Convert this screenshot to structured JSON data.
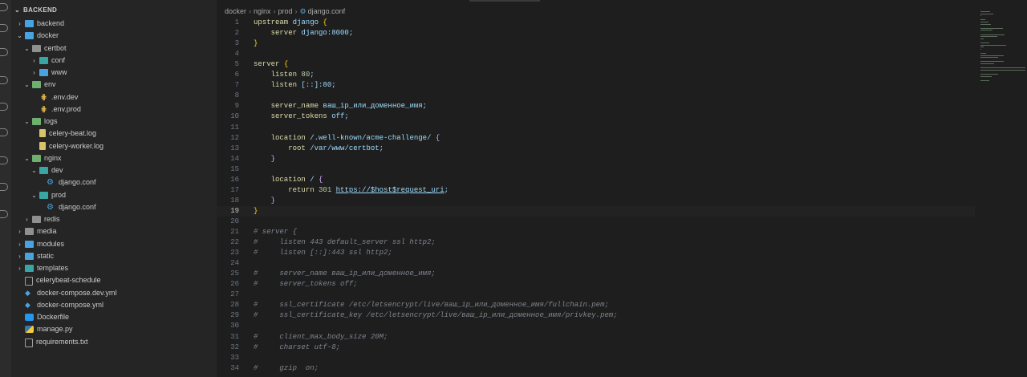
{
  "sidebar": {
    "header": "BACKEND",
    "items": [
      {
        "label": "backend",
        "depth": 1,
        "type": "folder",
        "icon": "folder-icon",
        "open": false,
        "color": "blue"
      },
      {
        "label": "docker",
        "depth": 1,
        "type": "folder",
        "icon": "docker-folder-icon",
        "open": true,
        "color": "blue"
      },
      {
        "label": "certbot",
        "depth": 2,
        "type": "folder",
        "icon": "folder-icon",
        "open": true,
        "color": "gray"
      },
      {
        "label": "conf",
        "depth": 3,
        "type": "folder",
        "icon": "config-folder-icon",
        "open": false,
        "color": "teal"
      },
      {
        "label": "www",
        "depth": 3,
        "type": "folder",
        "icon": "folder-icon",
        "open": false,
        "color": "blue"
      },
      {
        "label": "env",
        "depth": 2,
        "type": "folder",
        "icon": "env-folder-icon",
        "open": true,
        "color": "green"
      },
      {
        "label": ".env.dev",
        "depth": 3,
        "type": "env",
        "icon": "env-file-icon"
      },
      {
        "label": ".env.prod",
        "depth": 3,
        "type": "env",
        "icon": "env-file-icon"
      },
      {
        "label": "logs",
        "depth": 2,
        "type": "folder",
        "icon": "logs-folder-icon",
        "open": true,
        "color": "green"
      },
      {
        "label": "celery-beat.log",
        "depth": 3,
        "type": "log",
        "icon": "log-file-icon"
      },
      {
        "label": "celery-worker.log",
        "depth": 3,
        "type": "log",
        "icon": "log-file-icon"
      },
      {
        "label": "nginx",
        "depth": 2,
        "type": "folder",
        "icon": "nginx-folder-icon",
        "open": true,
        "color": "green"
      },
      {
        "label": "dev",
        "depth": 3,
        "type": "folder",
        "icon": "folder-icon",
        "open": true,
        "color": "teal"
      },
      {
        "label": "django.conf",
        "depth": 4,
        "type": "gear",
        "icon": "gear-icon"
      },
      {
        "label": "prod",
        "depth": 3,
        "type": "folder",
        "icon": "folder-icon",
        "open": true,
        "color": "teal"
      },
      {
        "label": "django.conf",
        "depth": 4,
        "type": "gear",
        "icon": "gear-icon"
      },
      {
        "label": "redis",
        "depth": 2,
        "type": "folder",
        "icon": "folder-icon",
        "open": false,
        "color": "gray"
      },
      {
        "label": "media",
        "depth": 1,
        "type": "folder",
        "icon": "folder-icon",
        "open": false,
        "color": "gray"
      },
      {
        "label": "modules",
        "depth": 1,
        "type": "folder",
        "icon": "folder-icon",
        "open": false,
        "color": "blue"
      },
      {
        "label": "static",
        "depth": 1,
        "type": "folder",
        "icon": "folder-icon",
        "open": false,
        "color": "blue"
      },
      {
        "label": "templates",
        "depth": 1,
        "type": "folder",
        "icon": "folder-icon",
        "open": false,
        "color": "teal"
      },
      {
        "label": "celerybeat-schedule",
        "depth": 1,
        "type": "txt",
        "icon": "file-icon"
      },
      {
        "label": "docker-compose.dev.yml",
        "depth": 1,
        "type": "yml",
        "icon": "docker-compose-icon"
      },
      {
        "label": "docker-compose.yml",
        "depth": 1,
        "type": "yml",
        "icon": "docker-compose-icon"
      },
      {
        "label": "Dockerfile",
        "depth": 1,
        "type": "docker",
        "icon": "docker-icon"
      },
      {
        "label": "manage.py",
        "depth": 1,
        "type": "py",
        "icon": "python-icon"
      },
      {
        "label": "requirements.txt",
        "depth": 1,
        "type": "txt",
        "icon": "text-file-icon"
      }
    ]
  },
  "breadcrumb": [
    "docker",
    "nginx",
    "prod",
    "django.conf"
  ],
  "editor": {
    "current_line": 19,
    "lines": [
      {
        "n": 1,
        "tokens": [
          [
            "dir",
            "upstream "
          ],
          [
            "word",
            "django "
          ],
          [
            "brace2",
            "{"
          ]
        ]
      },
      {
        "n": 2,
        "tokens": [
          [
            "plain",
            "    "
          ],
          [
            "dir",
            "server "
          ],
          [
            "word",
            "django:8000;"
          ]
        ]
      },
      {
        "n": 3,
        "tokens": [
          [
            "brace2",
            "}"
          ]
        ]
      },
      {
        "n": 4,
        "tokens": []
      },
      {
        "n": 5,
        "tokens": [
          [
            "dir",
            "server "
          ],
          [
            "brace2",
            "{"
          ]
        ]
      },
      {
        "n": 6,
        "tokens": [
          [
            "plain",
            "    "
          ],
          [
            "dir",
            "listen "
          ],
          [
            "num",
            "80"
          ],
          [
            "word",
            ";"
          ]
        ]
      },
      {
        "n": 7,
        "tokens": [
          [
            "plain",
            "    "
          ],
          [
            "dir",
            "listen "
          ],
          [
            "word",
            "[::]:80;"
          ]
        ]
      },
      {
        "n": 8,
        "tokens": []
      },
      {
        "n": 9,
        "tokens": [
          [
            "plain",
            "    "
          ],
          [
            "dir",
            "server_name "
          ],
          [
            "word",
            "ваш_ip_или_доменное_имя;"
          ]
        ]
      },
      {
        "n": 10,
        "tokens": [
          [
            "plain",
            "    "
          ],
          [
            "dir",
            "server_tokens "
          ],
          [
            "word",
            "off;"
          ]
        ]
      },
      {
        "n": 11,
        "tokens": []
      },
      {
        "n": 12,
        "tokens": [
          [
            "plain",
            "    "
          ],
          [
            "dir",
            "location "
          ],
          [
            "word",
            "/.well-known/acme-challenge/ "
          ],
          [
            "brace",
            "{"
          ]
        ]
      },
      {
        "n": 13,
        "tokens": [
          [
            "plain",
            "        "
          ],
          [
            "dir",
            "root "
          ],
          [
            "word",
            "/var/www/certbot;"
          ]
        ]
      },
      {
        "n": 14,
        "tokens": [
          [
            "plain",
            "    "
          ],
          [
            "brace",
            "}"
          ]
        ]
      },
      {
        "n": 15,
        "tokens": []
      },
      {
        "n": 16,
        "tokens": [
          [
            "plain",
            "    "
          ],
          [
            "dir",
            "location "
          ],
          [
            "word",
            "/ "
          ],
          [
            "brace",
            "{"
          ]
        ]
      },
      {
        "n": 17,
        "tokens": [
          [
            "plain",
            "        "
          ],
          [
            "dir",
            "return "
          ],
          [
            "num",
            "301 "
          ],
          [
            "url",
            "https://$host$request_uri"
          ],
          [
            "word",
            ";"
          ]
        ]
      },
      {
        "n": 18,
        "tokens": [
          [
            "plain",
            "    "
          ],
          [
            "brace",
            "}"
          ]
        ]
      },
      {
        "n": 19,
        "tokens": [
          [
            "brace2",
            "}"
          ]
        ]
      },
      {
        "n": 20,
        "tokens": []
      },
      {
        "n": 21,
        "tokens": [
          [
            "comment",
            "# server {"
          ]
        ]
      },
      {
        "n": 22,
        "tokens": [
          [
            "comment",
            "#     listen 443 default_server ssl http2;"
          ]
        ]
      },
      {
        "n": 23,
        "tokens": [
          [
            "comment",
            "#     listen [::]:443 ssl http2;"
          ]
        ]
      },
      {
        "n": 24,
        "tokens": []
      },
      {
        "n": 25,
        "tokens": [
          [
            "comment",
            "#     server_name ваш_ip_или_доменное_имя;"
          ]
        ]
      },
      {
        "n": 26,
        "tokens": [
          [
            "comment",
            "#     server_tokens off;"
          ]
        ]
      },
      {
        "n": 27,
        "tokens": []
      },
      {
        "n": 28,
        "tokens": [
          [
            "comment",
            "#     ssl_certificate /etc/letsencrypt/live/ваш_ip_или_доменное_имя/fullchain.pem;"
          ]
        ]
      },
      {
        "n": 29,
        "tokens": [
          [
            "comment",
            "#     ssl_certificate_key /etc/letsencrypt/live/ваш_ip_или_доменное_имя/privkey.pem;"
          ]
        ]
      },
      {
        "n": 30,
        "tokens": []
      },
      {
        "n": 31,
        "tokens": [
          [
            "comment",
            "#     client_max_body_size 20M;"
          ]
        ]
      },
      {
        "n": 32,
        "tokens": [
          [
            "comment",
            "#     charset utf-8;"
          ]
        ]
      },
      {
        "n": 33,
        "tokens": []
      },
      {
        "n": 34,
        "tokens": [
          [
            "comment",
            "#     gzip  on;"
          ]
        ]
      }
    ]
  }
}
